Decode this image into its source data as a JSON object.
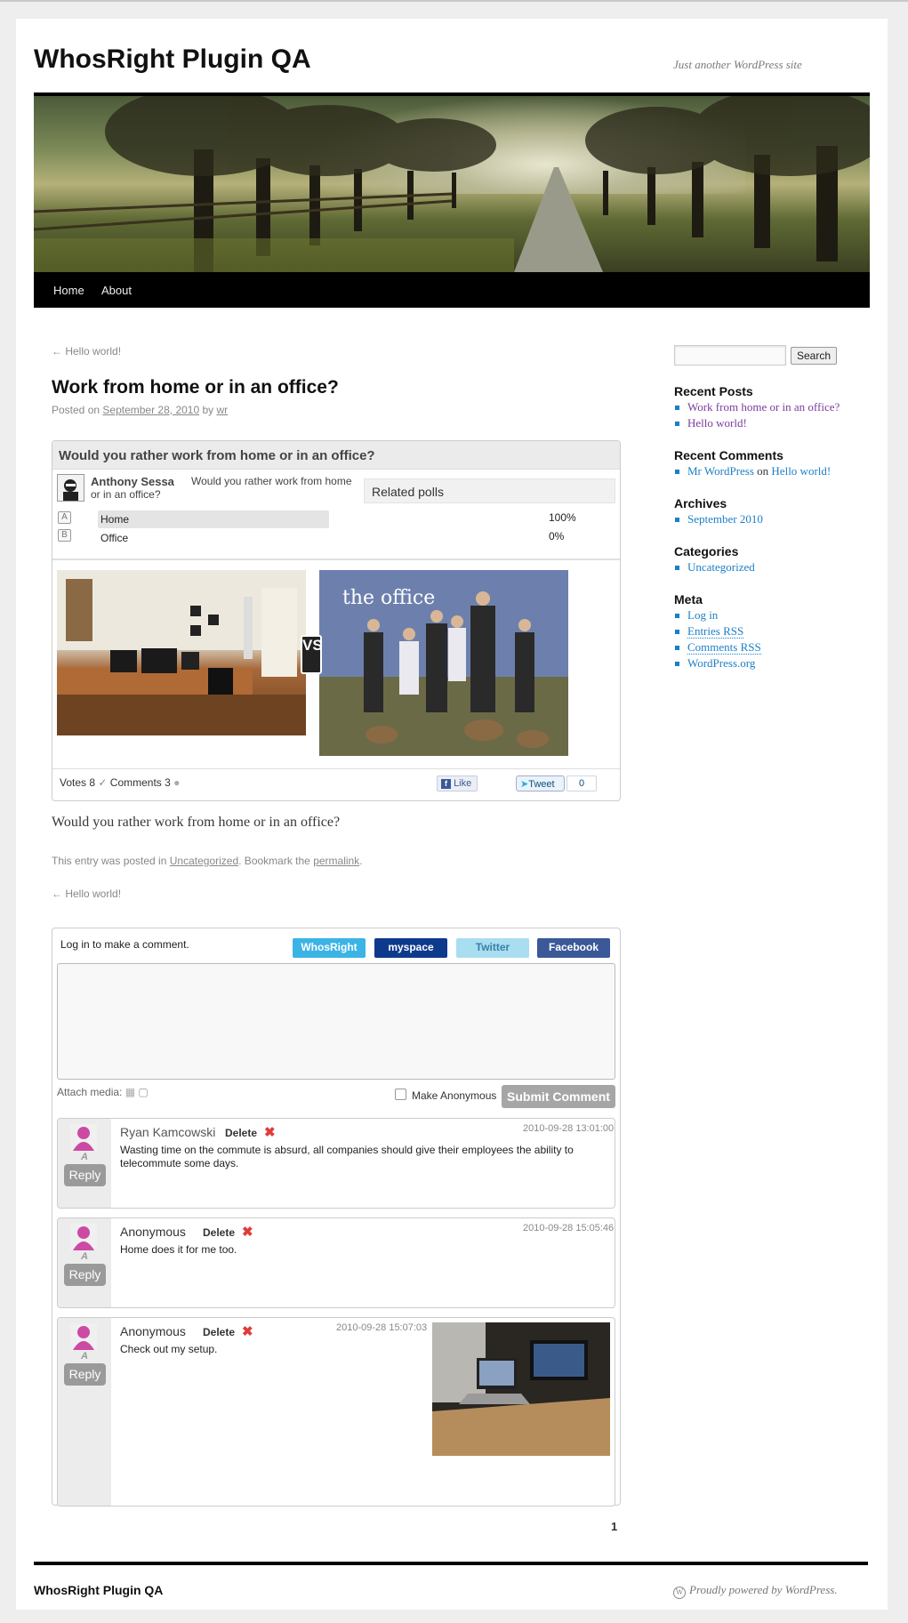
{
  "site": {
    "title": "WhosRight Plugin QA",
    "tagline": "Just another WordPress site"
  },
  "nav": {
    "items": [
      "Home",
      "About"
    ]
  },
  "post": {
    "prev_link_top": "← Hello world!",
    "title": "Work from home or in an office?",
    "meta_prefix": "Posted on",
    "meta_date": "September 28, 2010",
    "meta_by": "by",
    "meta_author": "wr",
    "body": "Would you rather work from home or in an office?",
    "footer_prefix": "This entry was posted in",
    "footer_category": "Uncategorized",
    "footer_mid": ". Bookmark the",
    "footer_permalink": "permalink",
    "footer_end": ".",
    "prev_link_bottom": "← Hello world!"
  },
  "poll": {
    "question": "Would you rather work from home or in an office?",
    "author": "Anthony Sessa",
    "author_question": "Would you rather work from home or in an office?",
    "related_label": "Related polls",
    "options": [
      {
        "letter": "A",
        "label": "Home",
        "pct": "100%",
        "fraction": 1.0
      },
      {
        "letter": "B",
        "label": "Office",
        "pct": "0%",
        "fraction": 0.0
      }
    ],
    "vs_label": "VS",
    "office_image_text": "the office",
    "votes_label": "Votes 8",
    "comments_label": "Comments 3",
    "like_label": "Like",
    "tweet_label": "Tweet",
    "tweet_count": "0"
  },
  "comment_form": {
    "login_prompt": "Log in to make a comment.",
    "social_buttons": [
      {
        "label": "WhosRight",
        "bg": "#3bb4e5",
        "color": "#ffffff"
      },
      {
        "label": "myspace",
        "bg": "#0e3a8c",
        "color": "#ffffff"
      },
      {
        "label": "Twitter",
        "bg": "#a9def0",
        "color": "#3a7fa8"
      },
      {
        "label": "Facebook",
        "bg": "#3b5998",
        "color": "#ffffff"
      }
    ],
    "attach_label": "Attach media:",
    "anonymous_label": "Make Anonymous",
    "submit_label": "Submit Comment"
  },
  "comments": [
    {
      "name": "Ryan Kamcowski",
      "delete": "Delete",
      "time": "2010-09-28 13:01:00",
      "text": "Wasting time on the commute is absurd, all companies should give their employees the ability to telecommute some days.",
      "badge": "A",
      "reply": "Reply"
    },
    {
      "name": "Anonymous",
      "delete": "Delete",
      "time": "2010-09-28 15:05:46",
      "text": "Home does it for me too.",
      "badge": "A",
      "reply": "Reply"
    },
    {
      "name": "Anonymous",
      "delete": "Delete",
      "time": "2010-09-28 15:07:03",
      "text": "Check out my setup.",
      "badge": "A",
      "reply": "Reply"
    }
  ],
  "pagination": {
    "current": "1"
  },
  "sidebar": {
    "search_button": "Search",
    "recent_posts_title": "Recent Posts",
    "recent_posts": [
      "Work from home or in an office?",
      "Hello world!"
    ],
    "recent_comments_title": "Recent Comments",
    "recent_comment": {
      "author": "Mr WordPress",
      "on": "on",
      "post": "Hello world!"
    },
    "archives_title": "Archives",
    "archives": [
      "September 2010"
    ],
    "categories_title": "Categories",
    "categories": [
      "Uncategorized"
    ],
    "meta_title": "Meta",
    "meta_links": [
      "Log in",
      "Entries RSS",
      "Comments RSS",
      "WordPress.org"
    ]
  },
  "footer": {
    "title": "WhosRight Plugin QA",
    "powered": "Proudly powered by WordPress."
  },
  "colors": {
    "link": "#1b8be0",
    "sidebar_link": "#1b7fc7",
    "visited": "#7a3b9e",
    "nav_bg": "#000000"
  }
}
